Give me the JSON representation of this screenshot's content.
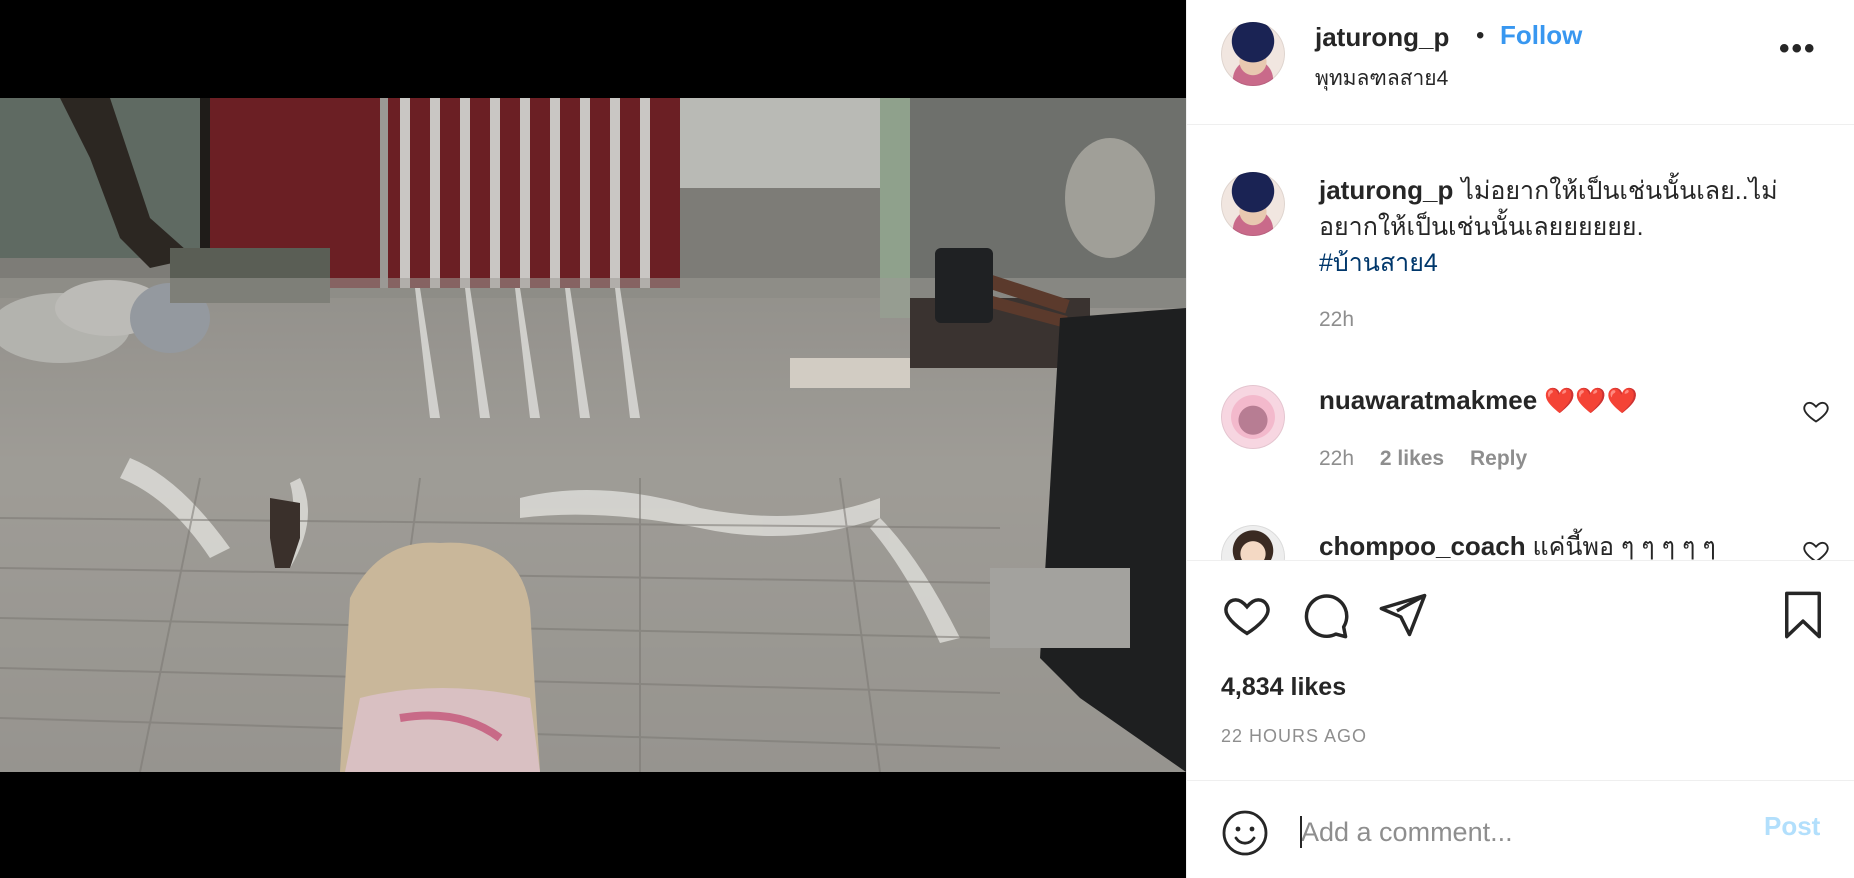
{
  "post": {
    "username": "jaturong_p",
    "follow_label": "Follow",
    "dot": "•",
    "location": "พุทมลฑลสาย4",
    "more_icon": "more-horizontal-icon"
  },
  "caption": {
    "username": "jaturong_p",
    "text": "ไม่อยากให้เป็นเช่นนั้นเลย..ไม่อยากให้เป็นเช่นนั้นเลยยยยยย.",
    "hashtag": "#บ้านสาย4",
    "time": "22h"
  },
  "comments": [
    {
      "username": "nuawaratmakmee",
      "text": "❤️❤️❤️",
      "time": "22h",
      "likes": "2 likes",
      "reply": "Reply"
    },
    {
      "username": "chompoo_coach",
      "text": "แค่นี้พอ ๆ ๆ ๆ ๆ ๆ"
    }
  ],
  "actions": {
    "likes": "4,834 likes",
    "ago": "22 HOURS AGO"
  },
  "composer": {
    "placeholder": "Add a comment...",
    "post_label": "Post"
  },
  "colors": {
    "link_blue": "#3897f0",
    "post_disabled": "#b2dffc",
    "hashtag": "#00376b",
    "muted": "#8e8e8e"
  }
}
